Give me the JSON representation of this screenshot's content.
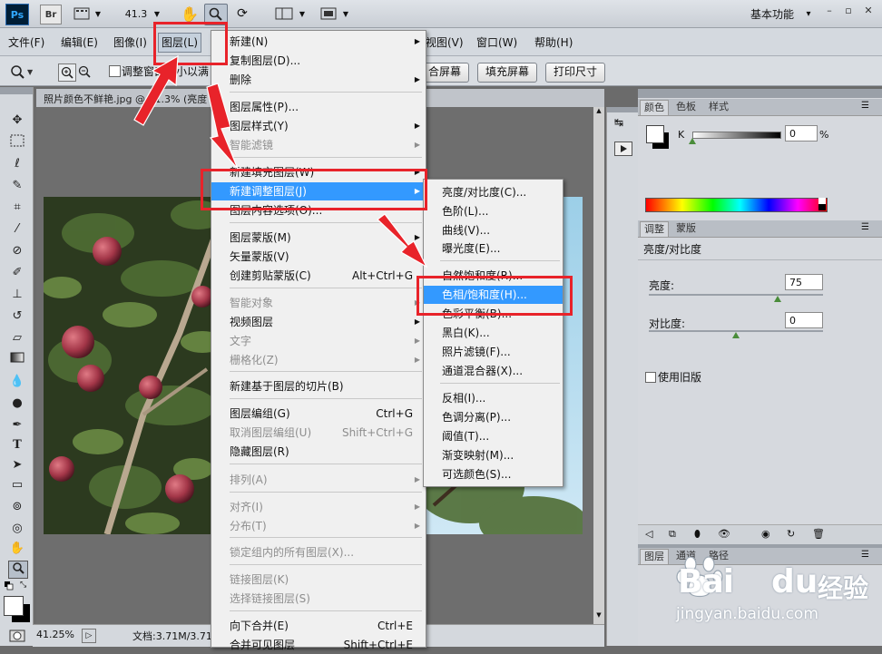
{
  "titlebar": {
    "ps_logo": "Ps",
    "br_logo": "Br",
    "zoom_value": "41.3",
    "workspace": "基本功能",
    "workspace_arrow": "▾"
  },
  "menubar": {
    "items": [
      "文件(F)",
      "编辑(E)",
      "图像(I)",
      "图层(L)",
      "视图(V)",
      "窗口(W)",
      "帮助(H)"
    ]
  },
  "options_bar": {
    "resize_windows": "调整窗口大小以满",
    "fit_screen": "合屏幕",
    "fill_screen": "填充屏幕",
    "print_size": "打印尺寸"
  },
  "document": {
    "tab_title": "照片颜色不鲜艳.jpg @ 41.3% (亮度",
    "zoom_status": "41.25%",
    "doc_status": "文档:3.71M/3.71"
  },
  "layer_menu": {
    "items": [
      {
        "label": "新建(N)",
        "shortcut": "",
        "submenu": true,
        "disabled": false
      },
      {
        "label": "复制图层(D)...",
        "shortcut": "",
        "submenu": false,
        "disabled": false
      },
      {
        "label": "删除",
        "shortcut": "",
        "submenu": true,
        "disabled": false
      },
      {
        "label": "图层属性(P)...",
        "shortcut": "",
        "submenu": false,
        "disabled": false
      },
      {
        "label": "图层样式(Y)",
        "shortcut": "",
        "submenu": true,
        "disabled": false
      },
      {
        "label": "智能滤镜",
        "shortcut": "",
        "submenu": true,
        "disabled": true
      },
      {
        "label": "新建填充图层(W)",
        "shortcut": "",
        "submenu": true,
        "disabled": false
      },
      {
        "label": "新建调整图层(J)",
        "shortcut": "",
        "submenu": true,
        "disabled": false
      },
      {
        "label": "图层内容选项(O)...",
        "shortcut": "",
        "submenu": false,
        "disabled": false
      },
      {
        "label": "图层蒙版(M)",
        "shortcut": "",
        "submenu": true,
        "disabled": false
      },
      {
        "label": "矢量蒙版(V)",
        "shortcut": "",
        "submenu": true,
        "disabled": false
      },
      {
        "label": "创建剪贴蒙版(C)",
        "shortcut": "Alt+Ctrl+G",
        "submenu": false,
        "disabled": false
      },
      {
        "label": "智能对象",
        "shortcut": "",
        "submenu": true,
        "disabled": true
      },
      {
        "label": "视频图层",
        "shortcut": "",
        "submenu": true,
        "disabled": false
      },
      {
        "label": "文字",
        "shortcut": "",
        "submenu": true,
        "disabled": true
      },
      {
        "label": "栅格化(Z)",
        "shortcut": "",
        "submenu": true,
        "disabled": true
      },
      {
        "label": "新建基于图层的切片(B)",
        "shortcut": "",
        "submenu": false,
        "disabled": false
      },
      {
        "label": "图层编组(G)",
        "shortcut": "Ctrl+G",
        "submenu": false,
        "disabled": false
      },
      {
        "label": "取消图层编组(U)",
        "shortcut": "Shift+Ctrl+G",
        "submenu": false,
        "disabled": true
      },
      {
        "label": "隐藏图层(R)",
        "shortcut": "",
        "submenu": false,
        "disabled": false
      },
      {
        "label": "排列(A)",
        "shortcut": "",
        "submenu": true,
        "disabled": true
      },
      {
        "label": "对齐(I)",
        "shortcut": "",
        "submenu": true,
        "disabled": true
      },
      {
        "label": "分布(T)",
        "shortcut": "",
        "submenu": true,
        "disabled": true
      },
      {
        "label": "锁定组内的所有图层(X)...",
        "shortcut": "",
        "submenu": false,
        "disabled": true
      },
      {
        "label": "链接图层(K)",
        "shortcut": "",
        "submenu": false,
        "disabled": true
      },
      {
        "label": "选择链接图层(S)",
        "shortcut": "",
        "submenu": false,
        "disabled": true
      },
      {
        "label": "向下合并(E)",
        "shortcut": "Ctrl+E",
        "submenu": false,
        "disabled": false
      },
      {
        "label": "合并可见图层",
        "shortcut": "Shift+Ctrl+E",
        "submenu": false,
        "disabled": false
      }
    ]
  },
  "adjustment_menu": {
    "items": [
      "亮度/对比度(C)...",
      "色阶(L)...",
      "曲线(V)...",
      "曝光度(E)...",
      "自然饱和度(R)...",
      "色相/饱和度(H)...",
      "色彩平衡(B)...",
      "黑白(K)...",
      "照片滤镜(F)...",
      "通道混合器(X)...",
      "反相(I)...",
      "色调分离(P)...",
      "阈值(T)...",
      "渐变映射(M)...",
      "可选颜色(S)..."
    ]
  },
  "color_panel": {
    "tabs": [
      "颜色",
      "色板",
      "样式"
    ],
    "channel": "K",
    "value": "0",
    "unit": "%"
  },
  "adjust_panel": {
    "tabs": [
      "调整",
      "蒙版"
    ],
    "title": "亮度/对比度",
    "brightness_label": "亮度:",
    "brightness_value": "75",
    "contrast_label": "对比度:",
    "contrast_value": "0",
    "legacy_label": "使用旧版"
  },
  "layers_panel": {
    "tabs": [
      "图层",
      "通道",
      "路径"
    ]
  },
  "watermark": {
    "brand_bai": "Bai",
    "brand_du": "du",
    "brand_cn": "经验",
    "url": "jingyan.baidu.com"
  },
  "colors": {
    "highlight": "#3399ff",
    "annotation_red": "#e8232a"
  }
}
